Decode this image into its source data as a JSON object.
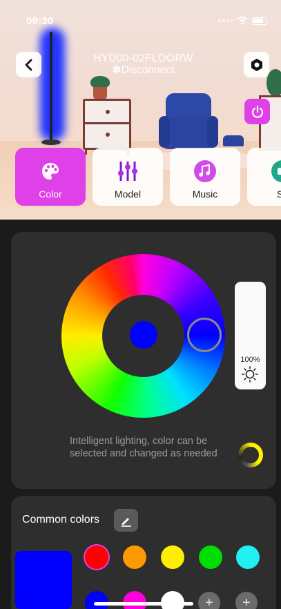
{
  "status_bar": {
    "time": "09:30"
  },
  "header": {
    "device_name": "HYD00-02FLOORW",
    "connection_status": "✽Disconnect"
  },
  "modes": [
    {
      "label": "Color",
      "icon": "palette-icon",
      "active": true
    },
    {
      "label": "Model",
      "icon": "sliders-icon",
      "active": false
    },
    {
      "label": "Music",
      "icon": "music-note-icon",
      "active": false
    },
    {
      "label": "Sc",
      "icon": "scene-icon",
      "active": false
    }
  ],
  "color_control": {
    "selected_color": "#0000ff",
    "brightness": "100%",
    "hint": "Intelligent lighting, color can be selected and changed as needed"
  },
  "common_colors": {
    "title": "Common colors",
    "current_color": "#0000ff",
    "swatches": [
      "#ff0000",
      "#ff9900",
      "#ffee00",
      "#00dd00",
      "#22f0f0",
      "#0000ff",
      "#ff00dd",
      "#ffffff"
    ],
    "add_label": "+"
  },
  "accent_color": "#e040e8"
}
